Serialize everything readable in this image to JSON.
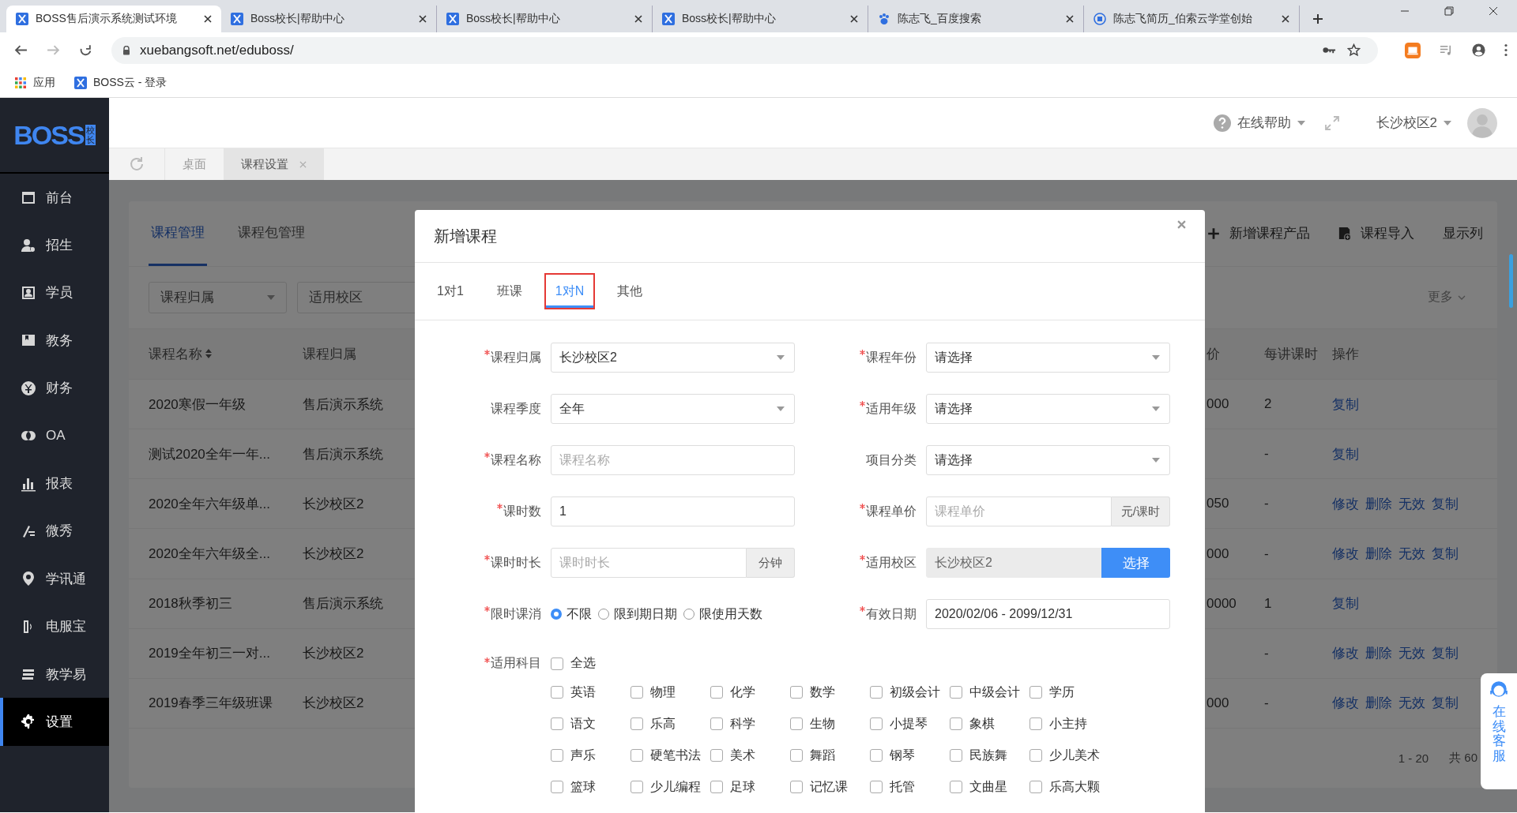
{
  "browser": {
    "tabs": [
      {
        "title": "BOSS售后演示系统测试环境",
        "kind": "boss",
        "selected": true
      },
      {
        "title": "Boss校长|帮助中心",
        "kind": "boss",
        "selected": false
      },
      {
        "title": "Boss校长|帮助中心",
        "kind": "boss",
        "selected": false
      },
      {
        "title": "Boss校长|帮助中心",
        "kind": "boss",
        "selected": false
      },
      {
        "title": "陈志飞_百度搜索",
        "kind": "paw",
        "selected": false
      },
      {
        "title": "陈志飞简历_伯索云学堂创始",
        "kind": "id",
        "selected": false
      }
    ],
    "address": "xuebangsoft.net/eduboss/",
    "bookmarks": [
      {
        "label": "应用",
        "kind": "apps"
      },
      {
        "label": "BOSS云 - 登录",
        "kind": "boss"
      }
    ]
  },
  "sidebar": {
    "logo": "BOSS",
    "logo_badge": "校长",
    "items": [
      {
        "label": "前台",
        "selected": false
      },
      {
        "label": "招生",
        "selected": false
      },
      {
        "label": "学员",
        "selected": false
      },
      {
        "label": "教务",
        "selected": false
      },
      {
        "label": "财务",
        "selected": false
      },
      {
        "label": "OA",
        "selected": false
      },
      {
        "label": "报表",
        "selected": false
      },
      {
        "label": "微秀",
        "selected": false
      },
      {
        "label": "学讯通",
        "selected": false
      },
      {
        "label": "电服宝",
        "selected": false
      },
      {
        "label": "教学易",
        "selected": false
      },
      {
        "label": "设置",
        "selected": true
      }
    ]
  },
  "header": {
    "help": "在线帮助",
    "campus": "长沙校区2"
  },
  "page_tabs": [
    {
      "label": "桌面",
      "selected": false,
      "closable": false
    },
    {
      "label": "课程设置",
      "selected": true,
      "closable": true
    }
  ],
  "content": {
    "tabs": [
      {
        "label": "课程管理",
        "selected": true
      },
      {
        "label": "课程包管理",
        "selected": false
      }
    ],
    "actions": [
      {
        "label": "新增课程产品",
        "kind": "add"
      },
      {
        "label": "课程导入",
        "kind": "import"
      },
      {
        "label": "显示列",
        "kind": "plain"
      }
    ],
    "filters": [
      "课程归属",
      "适用校区"
    ],
    "more": "更多",
    "table": {
      "columns": [
        {
          "label": "课程名称",
          "sortable": true
        },
        {
          "label": "课程归属",
          "sortable": false
        },
        {
          "label": "价",
          "sortable": false
        },
        {
          "label": "每讲课时",
          "sortable": false
        },
        {
          "label": "操作",
          "sortable": false
        }
      ],
      "rows": [
        {
          "name": "2020寒假一年级",
          "owner": "售后演示系统",
          "price": "000",
          "per_lecture": "2",
          "actions": [
            "复制"
          ]
        },
        {
          "name": "测试2020全年一年...",
          "owner": "售后演示系统",
          "per_lecture": "-",
          "actions": [
            "复制"
          ]
        },
        {
          "name": "2020全年六年级单...",
          "owner": "长沙校区2",
          "price": "050",
          "per_lecture": "-",
          "actions": [
            "修改",
            "删除",
            "无效",
            "复制"
          ]
        },
        {
          "name": "2020全年六年级全...",
          "owner": "长沙校区2",
          "price": "000",
          "per_lecture": "-",
          "actions": [
            "修改",
            "删除",
            "无效",
            "复制"
          ]
        },
        {
          "name": "2018秋季初三",
          "owner": "售后演示系统",
          "price": "0000",
          "per_lecture": "1",
          "actions": [
            "复制"
          ]
        },
        {
          "name": "2019全年初三一对...",
          "owner": "长沙校区2",
          "per_lecture": "-",
          "actions": [
            "修改",
            "删除",
            "无效",
            "复制"
          ]
        },
        {
          "name": "2019春季三年级班课",
          "owner": "长沙校区2",
          "price": "000",
          "per_lecture": "-",
          "actions": [
            "修改",
            "删除",
            "无效",
            "复制"
          ]
        }
      ]
    },
    "pagination": {
      "range": "1 - 20",
      "total": "共 60"
    }
  },
  "modal": {
    "title": "新增课程",
    "tabs": [
      {
        "label": "1对1",
        "selected": false,
        "highlighted": false
      },
      {
        "label": "班课",
        "selected": false,
        "highlighted": false
      },
      {
        "label": "1对N",
        "selected": true,
        "highlighted": true
      },
      {
        "label": "其他",
        "selected": false,
        "highlighted": false
      }
    ],
    "fields": [
      {
        "label": "课程归属",
        "required": true,
        "kind": "select",
        "value": "长沙校区2"
      },
      {
        "label": "课程年份",
        "required": true,
        "kind": "select",
        "value": "请选择"
      },
      {
        "label": "课程季度",
        "required": false,
        "kind": "select",
        "value": "全年"
      },
      {
        "label": "适用年级",
        "required": true,
        "kind": "select",
        "value": "请选择"
      },
      {
        "label": "课程名称",
        "required": true,
        "kind": "input",
        "placeholder": "课程名称"
      },
      {
        "label": "项目分类",
        "required": false,
        "kind": "select",
        "value": "请选择"
      },
      {
        "label": "课时数",
        "required": true,
        "kind": "input",
        "value": "1"
      },
      {
        "label": "课程单价",
        "required": true,
        "kind": "input",
        "placeholder": "课程单价",
        "addon": "元/课时"
      },
      {
        "label": "课时时长",
        "required": true,
        "kind": "input",
        "placeholder": "课时时长",
        "addon": "分钟"
      },
      {
        "label": "适用校区",
        "required": true,
        "kind": "picker",
        "value": "长沙校区2",
        "button": "选择"
      },
      {
        "label": "限时课消",
        "required": true,
        "kind": "radio",
        "options": [
          {
            "label": "不限",
            "selected": true
          },
          {
            "label": "限到期日期",
            "selected": false
          },
          {
            "label": "限使用天数",
            "selected": false
          }
        ]
      },
      {
        "label": "有效日期",
        "required": true,
        "kind": "input",
        "value": "2020/02/06 - 2099/12/31"
      }
    ],
    "subjects": {
      "label": "适用科目",
      "required": true,
      "select_all": {
        "label": "全选",
        "checked": false
      },
      "items": [
        {
          "label": "英语",
          "checked": false
        },
        {
          "label": "物理",
          "checked": false
        },
        {
          "label": "化学",
          "checked": false
        },
        {
          "label": "数学",
          "checked": false
        },
        {
          "label": "初级会计",
          "checked": false
        },
        {
          "label": "中级会计",
          "checked": false
        },
        {
          "label": "学历",
          "checked": false
        },
        {
          "label": "语文",
          "checked": false
        },
        {
          "label": "乐高",
          "checked": false
        },
        {
          "label": "科学",
          "checked": false
        },
        {
          "label": "生物",
          "checked": false
        },
        {
          "label": "小提琴",
          "checked": false
        },
        {
          "label": "象棋",
          "checked": false
        },
        {
          "label": "小主持",
          "checked": false
        },
        {
          "label": "声乐",
          "checked": false
        },
        {
          "label": "硬笔书法",
          "checked": false
        },
        {
          "label": "美术",
          "checked": false
        },
        {
          "label": "舞蹈",
          "checked": false
        },
        {
          "label": "钢琴",
          "checked": false
        },
        {
          "label": "民族舞",
          "checked": false
        },
        {
          "label": "少儿美术",
          "checked": false
        },
        {
          "label": "篮球",
          "checked": false
        },
        {
          "label": "少儿编程",
          "checked": false
        },
        {
          "label": "足球",
          "checked": false
        },
        {
          "label": "记忆课",
          "checked": false
        },
        {
          "label": "托管",
          "checked": false
        },
        {
          "label": "文曲星",
          "checked": false
        },
        {
          "label": "乐高大颗",
          "checked": false
        }
      ]
    }
  },
  "service_widget": "在线客服"
}
